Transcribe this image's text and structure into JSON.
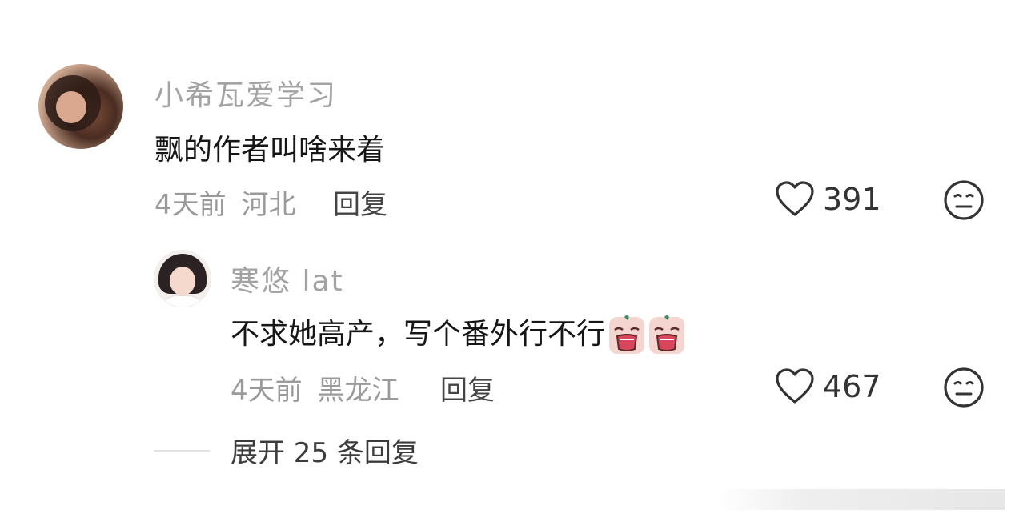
{
  "comment": {
    "username": "小希瓦爱学习",
    "text": "飘的作者叫啥来着",
    "time": "4天前",
    "location": "河北",
    "reply_label": "回复",
    "likes": "391"
  },
  "reply": {
    "username": "寒悠 lat",
    "text": "不求她高产，写个番外行不行",
    "emojis": [
      "crying-face-emoji",
      "crying-face-emoji"
    ],
    "time": "4天前",
    "location": "黑龙江",
    "reply_label": "回复",
    "likes": "467"
  },
  "expand": {
    "label": "展开 25 条回复"
  },
  "icons": {
    "like": "heart-outline-icon",
    "dislike": "neutral-face-icon"
  },
  "colors": {
    "username": "#a3a3a3",
    "text": "#161616",
    "meta": "#9a9a9a"
  }
}
